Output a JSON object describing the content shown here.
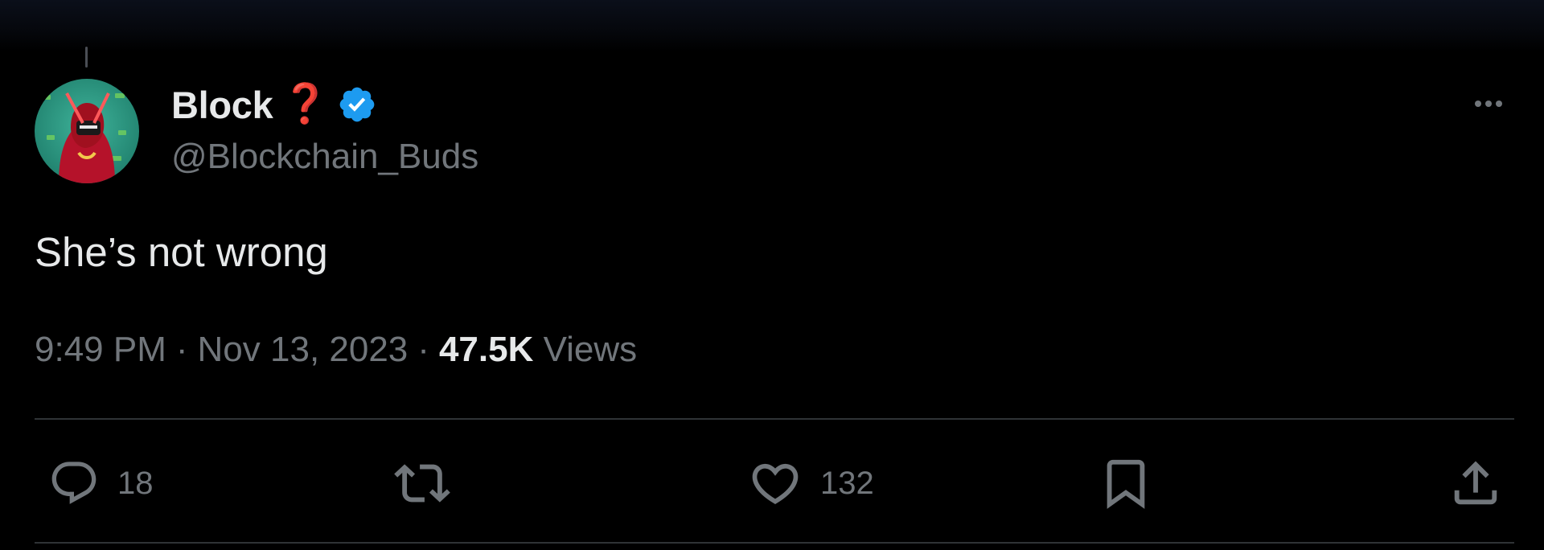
{
  "tweet": {
    "author": {
      "display_name": "Block",
      "name_emoji": "❓",
      "handle": "@Blockchain_Buds",
      "verified": true,
      "verified_color": "#1d9bf0"
    },
    "text": "She’s not wrong",
    "meta": {
      "time": "9:49 PM",
      "separator": "·",
      "date": "Nov 13, 2023",
      "views_count": "47.5K",
      "views_label": "Views"
    },
    "actions": {
      "reply": {
        "icon": "reply-icon",
        "count": "18"
      },
      "retweet": {
        "icon": "retweet-icon",
        "count": ""
      },
      "like": {
        "icon": "heart-icon",
        "count": "132"
      },
      "bookmark": {
        "icon": "bookmark-icon"
      },
      "share": {
        "icon": "share-icon"
      }
    },
    "more_icon": "more-dots-icon"
  },
  "colors": {
    "background": "#000000",
    "primary_text": "#e7e9ea",
    "secondary_text": "#71767b",
    "divider": "#2f3336",
    "verified": "#1d9bf0",
    "accent_red": "#d21d2c"
  }
}
